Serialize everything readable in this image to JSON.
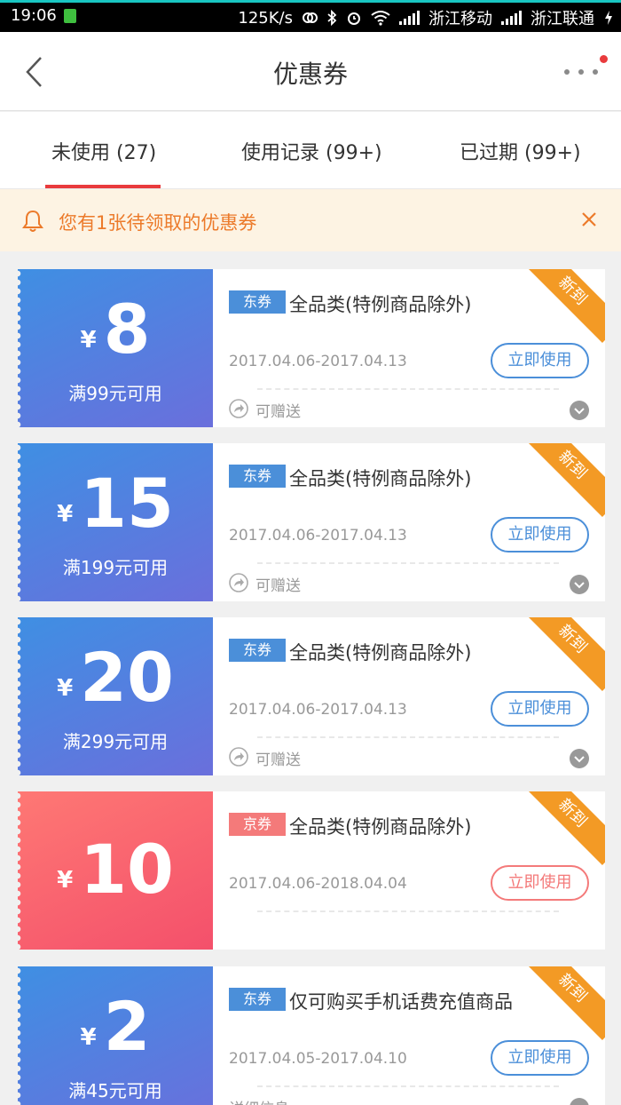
{
  "status_bar": {
    "time": "19:06",
    "speed": "125K/s",
    "carrier1": "浙江移动",
    "carrier2": "浙江联通"
  },
  "header": {
    "title": "优惠券"
  },
  "tabs": [
    {
      "label": "未使用 (27)",
      "active": true
    },
    {
      "label": "使用记录 (99+)",
      "active": false
    },
    {
      "label": "已过期 (99+)",
      "active": false
    }
  ],
  "notice": {
    "text": "您有1张待领取的优惠券"
  },
  "coupons": [
    {
      "yen": "¥",
      "amount": "8",
      "condition": "满99元可用",
      "badge": "东券",
      "title": "全品类(特例商品除外)",
      "ribbon": "新到",
      "date": "2017.04.06-2017.04.13",
      "button": "立即使用",
      "footer": "可赠送"
    },
    {
      "yen": "¥",
      "amount": "15",
      "condition": "满199元可用",
      "badge": "东券",
      "title": "全品类(特例商品除外)",
      "ribbon": "新到",
      "date": "2017.04.06-2017.04.13",
      "button": "立即使用",
      "footer": "可赠送"
    },
    {
      "yen": "¥",
      "amount": "20",
      "condition": "满299元可用",
      "badge": "东券",
      "title": "全品类(特例商品除外)",
      "ribbon": "新到",
      "date": "2017.04.06-2017.04.13",
      "button": "立即使用",
      "footer": "可赠送"
    },
    {
      "yen": "¥",
      "amount": "10",
      "badge": "京券",
      "title": "全品类(特例商品除外)",
      "ribbon": "新到",
      "date": "2017.04.06-2018.04.04",
      "button": "立即使用"
    },
    {
      "yen": "¥",
      "amount": "2",
      "condition": "满45元可用",
      "badge": "东券",
      "title": "仅可购买手机话费充值商品",
      "ribbon": "新到",
      "date": "2017.04.05-2017.04.10",
      "button": "立即使用",
      "footer": "详细信息"
    }
  ],
  "colors": {
    "accent_red": "#e93b3d",
    "coupon_blue": "#4b8fd9",
    "coupon_red": "#f47a7a",
    "ribbon_orange": "#f39a25",
    "notice_text": "#ec7a2a"
  }
}
